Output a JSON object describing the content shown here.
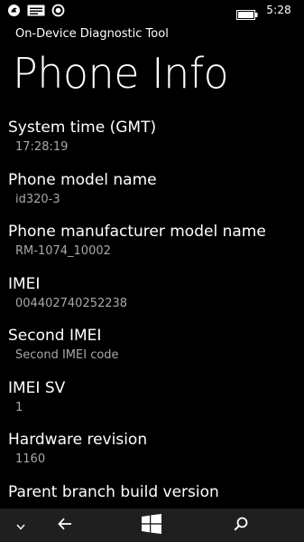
{
  "status_bar": {
    "time": "5:28",
    "icons": [
      "notification-icon",
      "message-icon",
      "location-icon",
      "battery-icon"
    ]
  },
  "app": {
    "subtitle": "On-Device Diagnostic Tool",
    "title": "Phone Info"
  },
  "info": [
    {
      "label": "System time (GMT)",
      "value": "17:28:19"
    },
    {
      "label": "Phone model name",
      "value": "id320-3"
    },
    {
      "label": "Phone manufacturer model name",
      "value": "RM-1074_10002"
    },
    {
      "label": "IMEI",
      "value": "004402740252238"
    },
    {
      "label": "Second IMEI",
      "value": "Second IMEI code"
    },
    {
      "label": "IMEI SV",
      "value": "1"
    },
    {
      "label": "Hardware revision",
      "value": "1160"
    },
    {
      "label": "Parent branch build version",
      "value": ""
    }
  ],
  "nav_bar": {
    "buttons": [
      "chevron-down-icon",
      "back-arrow-icon",
      "windows-start-icon",
      "search-icon"
    ]
  }
}
